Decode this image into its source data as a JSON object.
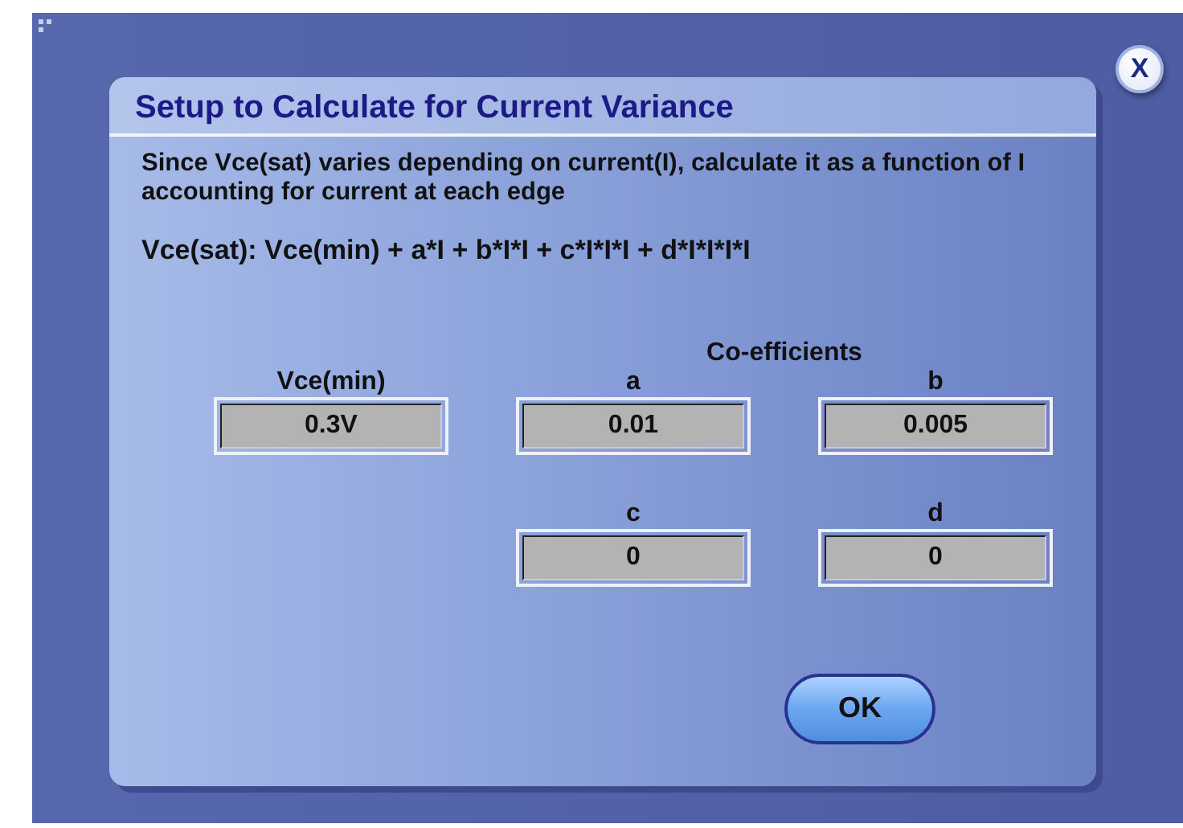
{
  "close_button": {
    "label": "X"
  },
  "dialog": {
    "title": "Setup to Calculate for Current Variance",
    "description": "Since Vce(sat) varies depending on current(I), calculate it as a function of I accounting for current at each edge",
    "formula": "Vce(sat): Vce(min) + a*I + b*I*I + c*I*I*I + d*I*I*I*I",
    "min_field": {
      "label": "Vce(min)",
      "value": "0.3V"
    },
    "coefficients": {
      "heading": "Co-efficients",
      "fields": [
        {
          "label": "a",
          "value": "0.01"
        },
        {
          "label": "b",
          "value": "0.005"
        },
        {
          "label": "c",
          "value": "0"
        },
        {
          "label": "d",
          "value": "0"
        }
      ]
    },
    "buttons": [
      {
        "label": "OK"
      }
    ]
  }
}
